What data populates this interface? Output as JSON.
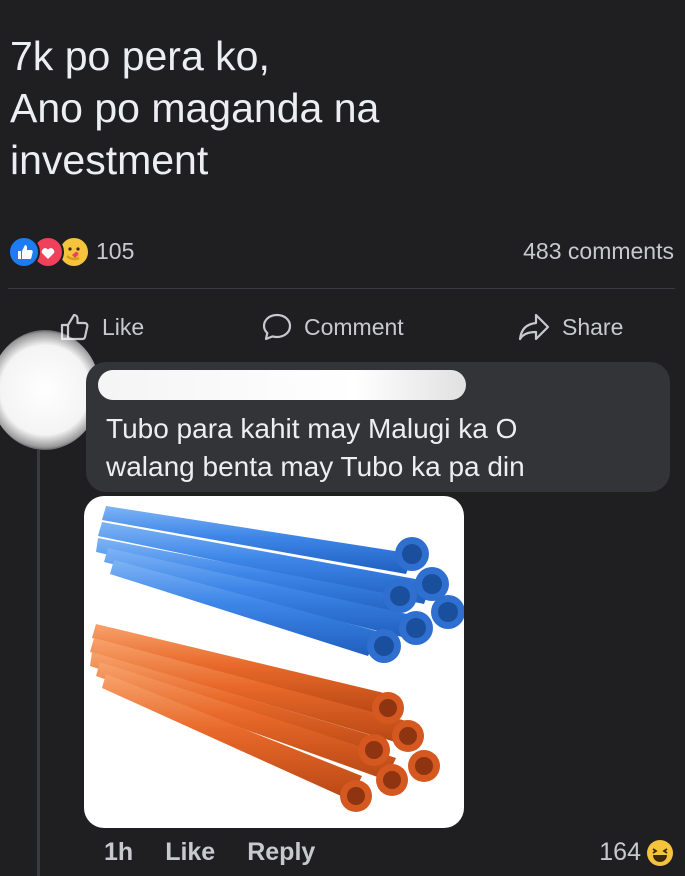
{
  "post": {
    "text": "7k po pera ko,\nAno po maganda na\ninvestment"
  },
  "reactions": {
    "count": "105",
    "icons": [
      "like-icon",
      "love-icon",
      "care-icon"
    ],
    "comments_count": "483 comments"
  },
  "actions": {
    "like": "Like",
    "comment": "Comment",
    "share": "Share"
  },
  "comment": {
    "text": "Tubo para kahit may Malugi ka O\nwalang benta may Tubo ka pa din",
    "time": "1h",
    "like_label": "Like",
    "reply_label": "Reply",
    "reaction_count": "164",
    "reaction_icon": "haha-icon"
  },
  "colors": {
    "background": "#1f1f22",
    "bubble": "#333437",
    "blue_pipe": "#3d86e8",
    "orange_pipe": "#e8692a"
  }
}
